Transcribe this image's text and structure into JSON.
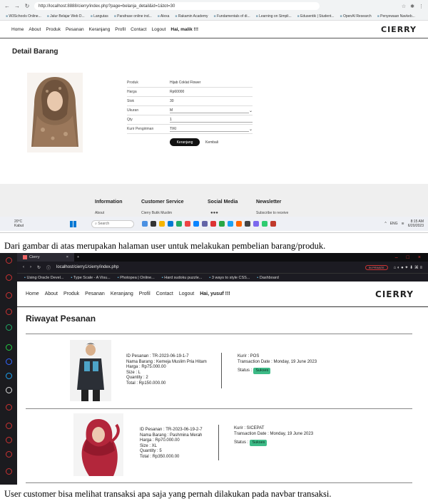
{
  "screen1": {
    "url": "http://localhost:8888/cierry/index.php?page=belanja_detail&id=1&tot=30",
    "bookmarks": [
      "W3Schools Online...",
      "Jalur Belajar Web D...",
      "Langutas",
      "Parafrase online ind...",
      "Alexa",
      "Rakamin Academy",
      "Fundamentals of di...",
      "Learning on Simpli...",
      "Edusentik | Student...",
      "OpenAI Research",
      "Penyewaan Navkeb..."
    ],
    "nav": [
      "Home",
      "About",
      "Produk",
      "Pesanan",
      "Keranjang",
      "Profil",
      "Contact",
      "Logout"
    ],
    "greeting": "Hai, malik !!!",
    "brand": "CIERRY",
    "page_title": "Detail Barang",
    "fields": [
      {
        "label": "Produk",
        "value": "Hijab Coklat Flower"
      },
      {
        "label": "Harga",
        "value": "Rp60000"
      },
      {
        "label": "Stok",
        "value": "30"
      },
      {
        "label": "Ukuran",
        "value": "M"
      },
      {
        "label": "Qty",
        "value": "1"
      },
      {
        "label": "Kurir Pengiriman",
        "value": "TIKI"
      }
    ],
    "btn_cart": "Keranjang",
    "btn_back": "Kembali",
    "footer": {
      "cols": [
        "Information",
        "Customer Service",
        "Social Media",
        "Newsletter"
      ],
      "subs": [
        "About",
        "Cierry Butik Muslim",
        "Subscribe to receive"
      ]
    },
    "taskbar": {
      "temp": "20°C",
      "weather": "Kabut",
      "search": "Search",
      "lang": "ENG",
      "time": "8:15 AM",
      "date": "6/20/2023"
    }
  },
  "caption1": "Dari gambar di atas merupakan halaman user untuk melakukan pembelian barang/produk.",
  "screen2": {
    "tab_title": "Cierry",
    "url": "localhost/cierry1/cierry/index.php",
    "incognito": "IN PRIVATE",
    "bookmarks": [
      "Using Oracle Devel...",
      "Type Scale - A Visu...",
      "Photopea | Online...",
      "Hard sudoku puzzle...",
      "3 ways to style CSS...",
      "Dashboard"
    ],
    "nav": [
      "Home",
      "About",
      "Produk",
      "Pesanan",
      "Keranjang",
      "Profil",
      "Contact",
      "Logout"
    ],
    "greeting": "Hai, yusuf !!!",
    "brand": "CIERRY",
    "page_title": "Riwayat Pesanan",
    "orders": [
      {
        "lines": [
          "ID Pesanan : TR-2023-06-19-1-7",
          "Nama Barang : Kemeja Muslim Pria Hitam",
          "Harga : Rp75.000.00",
          "Size : L",
          "Quantity : 2",
          "Total : Rp150.000.00"
        ],
        "kurir": "Kurir : POS",
        "date": "Transaction Date : Monday, 19 June 2023",
        "status_label": "Status :",
        "status": "Sukses"
      },
      {
        "lines": [
          "ID Pesanan : TR-2023-06-19-2-7",
          "Nama Barang : Pashmina Merah",
          "Harga : Rp70.000.00",
          "Size : XL",
          "Quantity : 5",
          "Total : Rp350.000.00"
        ],
        "kurir": "Kurir : SICEPAT",
        "date": "Transaction Date : Monday, 19 June 2023",
        "status_label": "Status :",
        "status": "Sukses"
      }
    ]
  },
  "caption2": "User customer bisa melihat transaksi apa saja yang pernah dilakukan pada navbar transaksi.",
  "colors": {
    "status_badge": "#3dbb87",
    "dark_chrome": "#1c1b22",
    "footer_bg": "#efefef"
  }
}
